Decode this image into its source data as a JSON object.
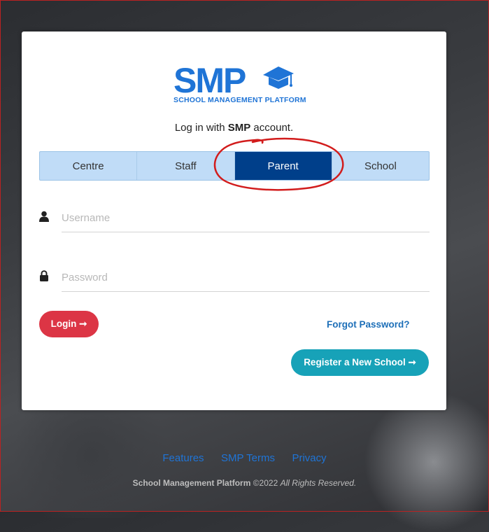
{
  "logo": {
    "main": "SMP",
    "subtitle": "SCHOOL MANAGEMENT PLATFORM",
    "color": "#1f74d6"
  },
  "login_prompt": {
    "prefix": "Log in with",
    "brand": "SMP",
    "suffix": "account."
  },
  "tabs": [
    {
      "label": "Centre",
      "active": false
    },
    {
      "label": "Staff",
      "active": false
    },
    {
      "label": "Parent",
      "active": true
    },
    {
      "label": "School",
      "active": false
    }
  ],
  "form": {
    "username_placeholder": "Username",
    "password_placeholder": "Password",
    "username_icon": "user-icon",
    "password_icon": "lock-icon"
  },
  "buttons": {
    "login": "Login ➞",
    "forgot": "Forgot Password?",
    "register": "Register a New School ➞"
  },
  "footer": {
    "links": [
      "Features",
      "SMP Terms",
      "Privacy"
    ],
    "copyright_name": "School Management Platform",
    "copyright_year": "©2022",
    "copyright_rights": "All Rights Reserved."
  },
  "colors": {
    "tab_active": "#003f8a",
    "tab_inactive": "#c0dcf7",
    "login_button": "#dc3545",
    "register_button": "#17a2b8",
    "annotation_circle": "#d21c1c"
  }
}
